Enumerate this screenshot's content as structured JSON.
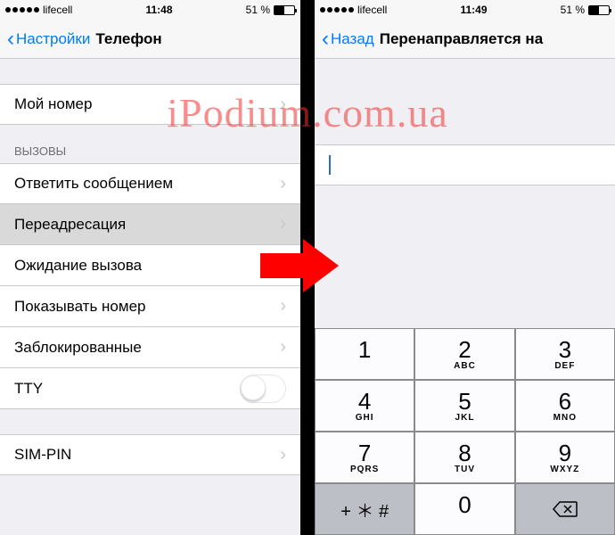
{
  "watermark": "iPodium.com.ua",
  "left": {
    "status": {
      "carrier": "lifecell",
      "time": "11:48",
      "battery_pct": "51 %"
    },
    "nav": {
      "back": "Настройки",
      "title": "Телефон"
    },
    "my_number": {
      "label": "Мой номер"
    },
    "calls_group": "ВЫЗОВЫ",
    "rows": {
      "respond": "Ответить сообщением",
      "forwarding": "Переадресация",
      "waiting": "Ожидание вызова",
      "show_id": "Показывать номер",
      "blocked": "Заблокированные",
      "tty": "TTY",
      "sim_pin": "SIM-PIN"
    }
  },
  "right": {
    "status": {
      "carrier": "lifecell",
      "time": "11:49",
      "battery_pct": "51 %"
    },
    "nav": {
      "back": "Назад",
      "title": "Перенаправляется на"
    },
    "keypad": {
      "k1": {
        "d": "1",
        "l": ""
      },
      "k2": {
        "d": "2",
        "l": "ABC"
      },
      "k3": {
        "d": "3",
        "l": "DEF"
      },
      "k4": {
        "d": "4",
        "l": "GHI"
      },
      "k5": {
        "d": "5",
        "l": "JKL"
      },
      "k6": {
        "d": "6",
        "l": "MNO"
      },
      "k7": {
        "d": "7",
        "l": "PQRS"
      },
      "k8": {
        "d": "8",
        "l": "TUV"
      },
      "k9": {
        "d": "9",
        "l": "WXYZ"
      },
      "kstar": "+ ＊ #",
      "k0": "0"
    }
  }
}
